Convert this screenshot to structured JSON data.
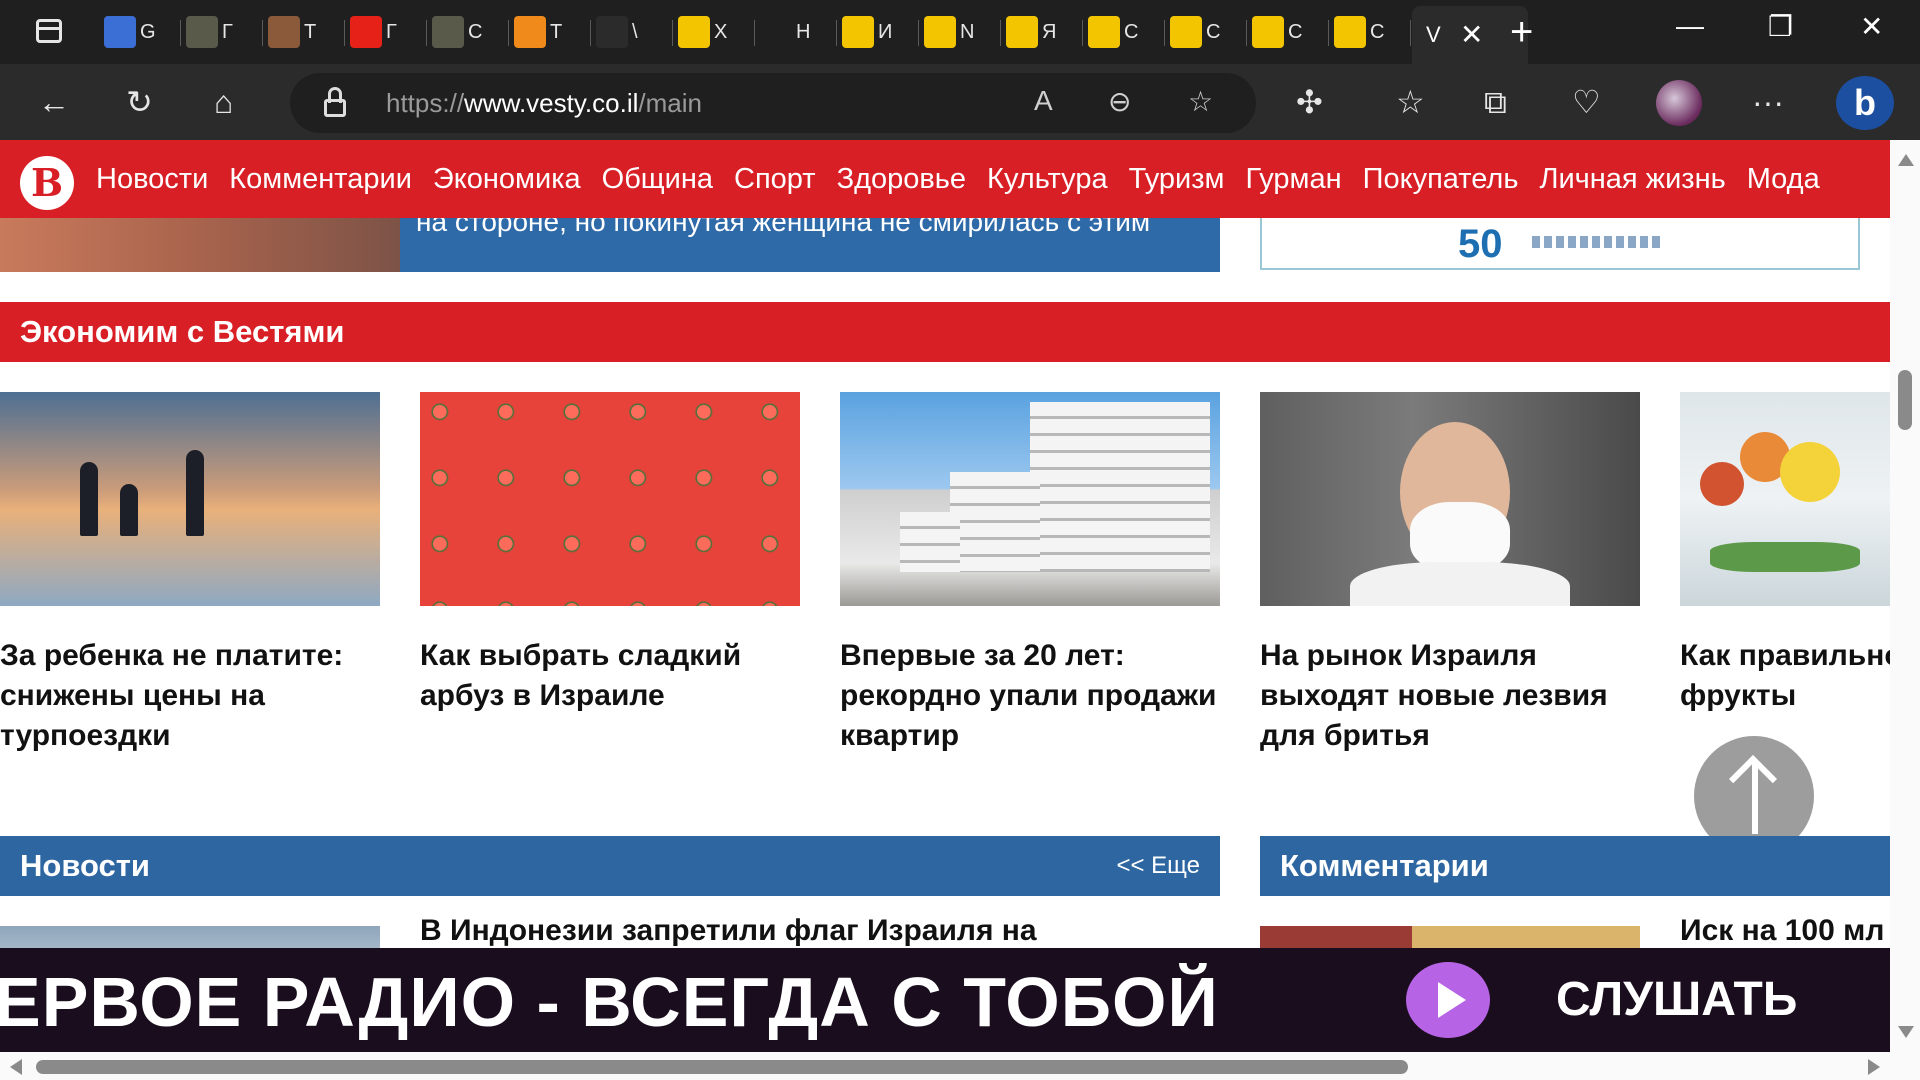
{
  "browser": {
    "tabs": [
      {
        "icon": "translate-icon",
        "text": "G",
        "color": "#3b6fd6"
      },
      {
        "icon": "page-icon",
        "text": "Г",
        "color": "#5a5a4a"
      },
      {
        "icon": "brown-icon",
        "text": "Т",
        "color": "#8a5a3a"
      },
      {
        "icon": "youtube-icon",
        "text": "Г",
        "color": "#e62117"
      },
      {
        "icon": "page-icon",
        "text": "С",
        "color": "#5a5a4a"
      },
      {
        "icon": "orange-b-icon",
        "text": "Т",
        "color": "#f08a1a"
      },
      {
        "icon": "frog-icon",
        "text": "\\",
        "color": "#2b2b2b"
      },
      {
        "icon": "pencil-icon",
        "text": "X",
        "color": "#f2c500"
      },
      {
        "icon": "speaker-icon",
        "text": "Н",
        "color": "#1f1f1f"
      },
      {
        "icon": "pencil-icon",
        "text": "И",
        "color": "#f2c500"
      },
      {
        "icon": "pencil-icon",
        "text": "N",
        "color": "#f2c500"
      },
      {
        "icon": "pencil-icon",
        "text": "Я",
        "color": "#f2c500"
      },
      {
        "icon": "pencil-icon",
        "text": "С",
        "color": "#f2c500"
      },
      {
        "icon": "pencil-icon",
        "text": "С",
        "color": "#f2c500"
      },
      {
        "icon": "pencil-icon",
        "text": "С",
        "color": "#f2c500"
      },
      {
        "icon": "pencil-icon",
        "text": "С",
        "color": "#f2c500"
      }
    ],
    "active_tab": {
      "text": "V",
      "close": "✕"
    },
    "new_tab": "+",
    "window": {
      "minimize": "—",
      "restore": "❐",
      "close": "✕"
    },
    "toolbar": {
      "back": "←",
      "reload": "↻",
      "home": "⌂",
      "more": "···"
    },
    "url": {
      "scheme": "https://",
      "domain": "www.vesty.co.il",
      "path": "/main"
    },
    "address_icons": {
      "read_aloud": "A",
      "zoom": "⊖",
      "favorite": "☆"
    },
    "right_icons": {
      "extensions": "✣",
      "favorites": "☆",
      "collections": "⧉",
      "health": "♡"
    },
    "bing": "b"
  },
  "site": {
    "logo": "В",
    "nav": [
      "Новости",
      "Комментарии",
      "Экономика",
      "Община",
      "Спорт",
      "Здоровье",
      "Культура",
      "Туризм",
      "Гурман",
      "Покупатель",
      "Личная жизнь",
      "Мода"
    ],
    "top_strip_text": "на стороне, но покинутая женщина не смирилась с этим",
    "ad_logo": "50",
    "economy_section": "Экономим с Вестями",
    "cards": [
      {
        "title": "За ребенка не платите: снижены цены на турпоездки"
      },
      {
        "title": "Как выбрать сладкий арбуз в Израиле"
      },
      {
        "title": "Впервые за 20 лет: рекордно упали продажи квартир"
      },
      {
        "title": "На рынок Израиля выходят новые лезвия для бритья"
      },
      {
        "title": "Как правильно летом фрукты"
      }
    ],
    "news_section": {
      "title": "Новости",
      "more": "<< Еще"
    },
    "comments_section": {
      "title": "Комментарии"
    },
    "news_headline": "В Индонезии запретили флаг Израиля на",
    "comments_headline": "Иск на 100 мл",
    "radio": {
      "slogan": "ЕРВОЕ РАДИО - ВСЕГДА С ТОБОЙ",
      "listen": "СЛУШАТЬ"
    }
  }
}
